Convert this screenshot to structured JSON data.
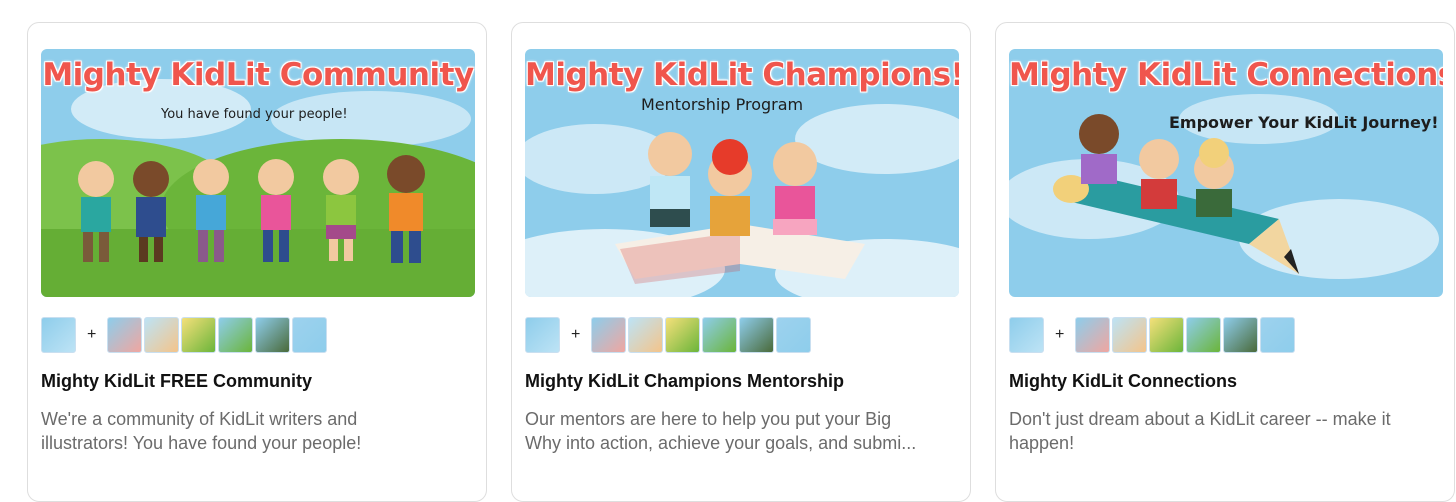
{
  "cards": [
    {
      "banner_title": "Mighty KidLit Community",
      "banner_subtitle": "You have found your people!",
      "title": "Mighty KidLit FREE Community",
      "description_line1": "We're a community of KidLit writers and",
      "description_line2": "illustrators! You have found your people!",
      "plus": "+"
    },
    {
      "banner_title": "Mighty KidLit Champions!",
      "banner_subtitle": "Mentorship Program",
      "title": "Mighty KidLit Champions Mentorship",
      "description_line1": "Our mentors are here to help you put your Big",
      "description_line2": "Why into action, achieve your goals, and submi...",
      "plus": "+"
    },
    {
      "banner_title": "Mighty KidLit Connections",
      "banner_subtitle": "Empower Your KidLit Journey!",
      "title": "Mighty KidLit Connections",
      "description_line1": "Don't just dream about a KidLit career -- make it",
      "description_line2": "happen!",
      "plus": "+"
    }
  ],
  "colors": {
    "sky": "#8ecdeb",
    "grass": "#6bb53a",
    "title_red": "#f0564d",
    "card_border": "#dedede",
    "description_gray": "#6b6b6b"
  }
}
